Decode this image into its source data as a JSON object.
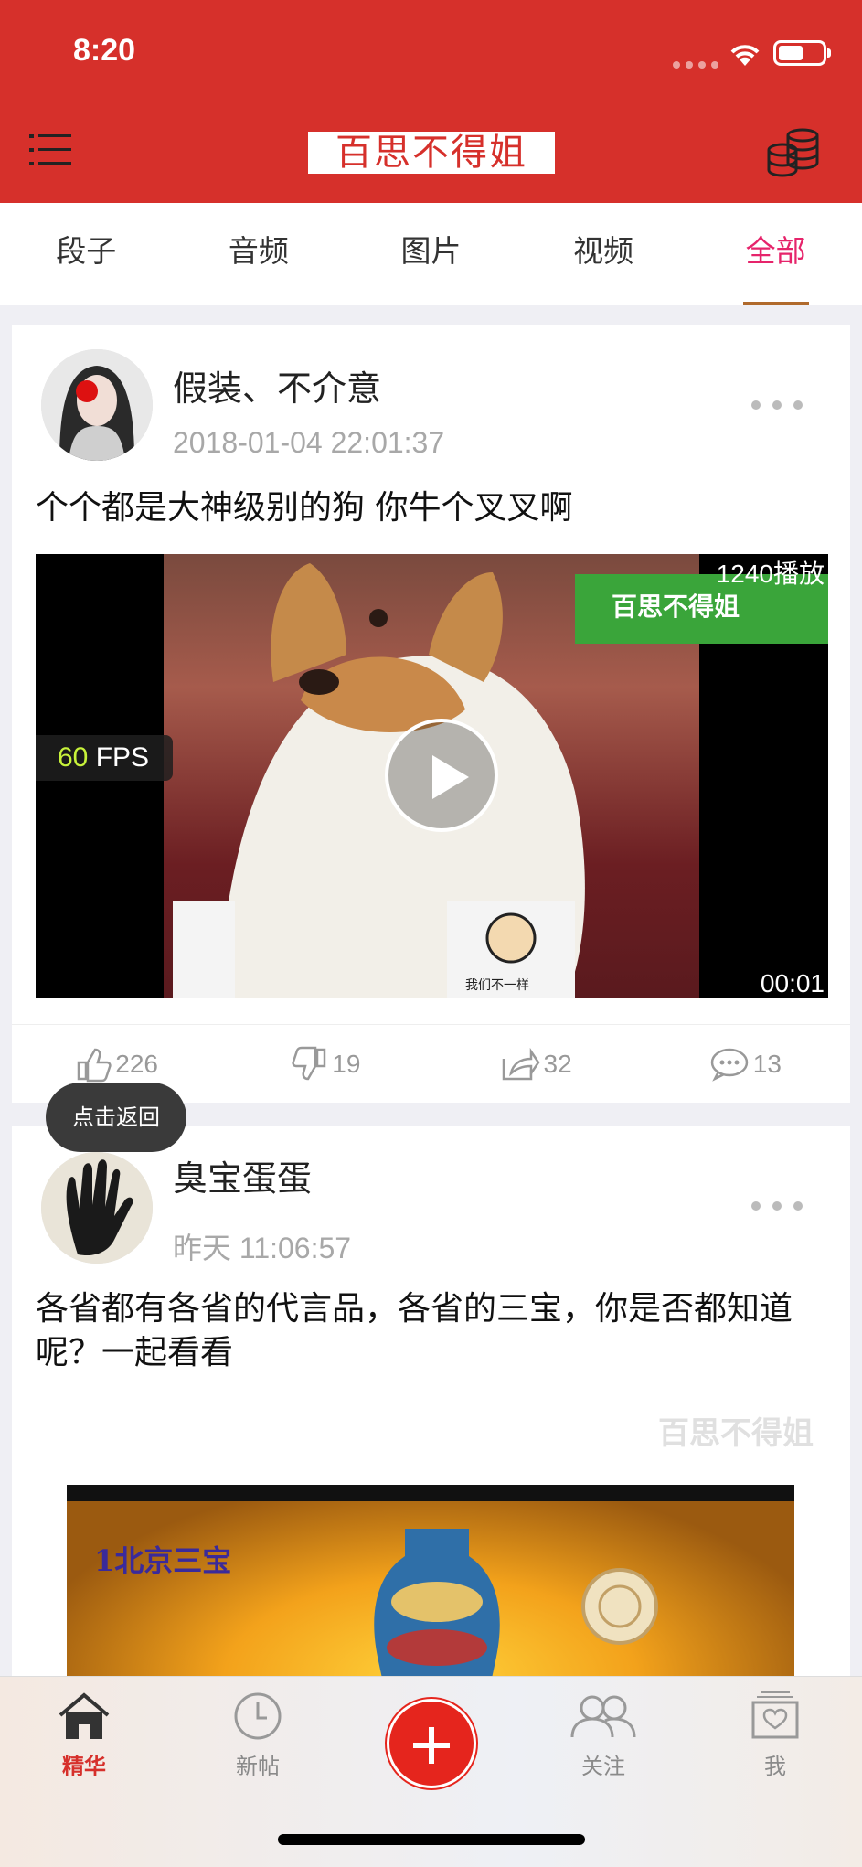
{
  "status": {
    "time": "8:20"
  },
  "header": {
    "title": "百思不得姐"
  },
  "tabs": [
    {
      "label": "段子"
    },
    {
      "label": "音频"
    },
    {
      "label": "图片"
    },
    {
      "label": "视频"
    },
    {
      "label": "全部",
      "active": true
    }
  ],
  "posts": [
    {
      "username": "假装、不介意",
      "time": "2018-01-04 22:01:37",
      "text": "个个都是大神级别的狗 你牛个叉叉啊",
      "video": {
        "play_count": "1240播放",
        "duration": "00:01",
        "fps_value": "60",
        "fps_unit": "FPS",
        "overlay_brand": "百思不得姐",
        "overlay_caption": "我们不一样"
      },
      "stats": {
        "likes": "226",
        "dislikes": "19",
        "shares": "32",
        "comments": "13"
      }
    },
    {
      "username": "臭宝蛋蛋",
      "time": "昨天 11:06:57",
      "text": "各省都有各省的代言品，各省的三宝，你是否都知道呢？一起看看",
      "image": {
        "watermark": "百思不得姐",
        "caption": "1北京三宝"
      }
    }
  ],
  "tooltip": "点击返回",
  "bottom_nav": [
    {
      "label": "精华",
      "icon": "home-icon",
      "active": true
    },
    {
      "label": "新帖",
      "icon": "clock-icon"
    },
    {
      "label": "关注",
      "icon": "friends-icon"
    },
    {
      "label": "我",
      "icon": "profile-icon"
    }
  ],
  "colors": {
    "brand_red": "#d6302b",
    "active_tab": "#e6246b",
    "tab_underline": "#b06a2c"
  }
}
